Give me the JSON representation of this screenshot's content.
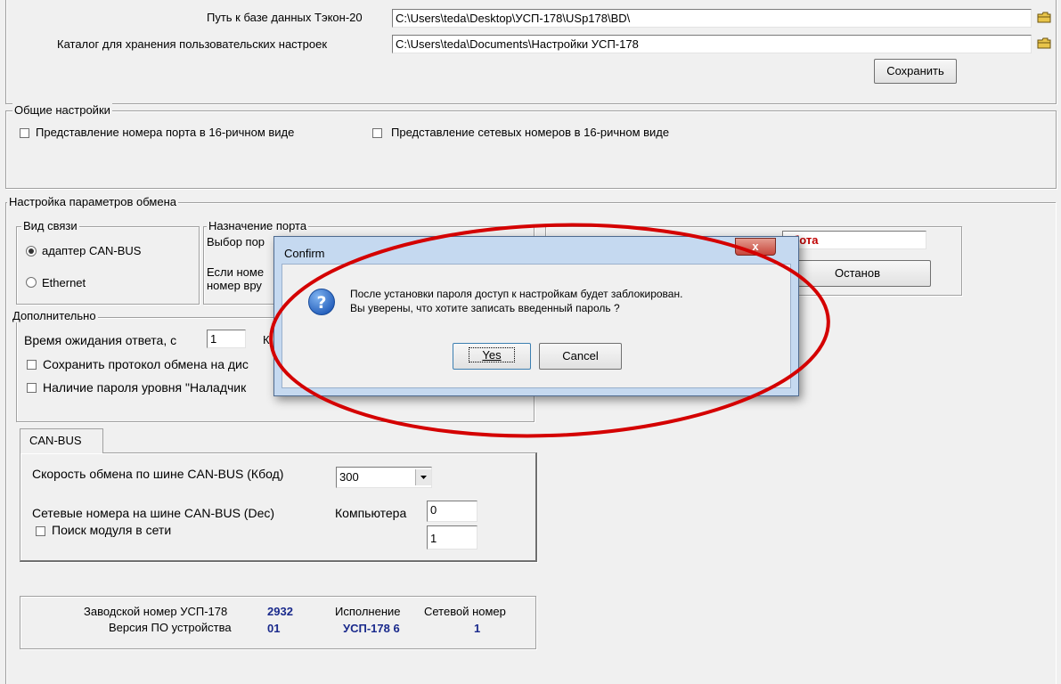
{
  "paths": {
    "db_label": "Путь к базе данных Тэкон-20",
    "db_value": "C:\\Users\\teda\\Desktop\\УСП-178\\USp178\\BD\\",
    "settings_label": "Каталог для хранения пользовательских настроек",
    "settings_value": "C:\\Users\\teda\\Documents\\Настройки УСП-178",
    "save_button": "Сохранить"
  },
  "general": {
    "title": "Общие настройки",
    "port_hex": "Представление номера порта в 16-ричном виде",
    "net_hex": "Представление сетевых номеров в 16-ричном виде"
  },
  "exchange": {
    "title": "Настройка параметров обмена",
    "link": {
      "title": "Вид связи",
      "can_bus": "адаптер CAN-BUS",
      "ethernet": "Ethernet"
    },
    "port": {
      "title": "Назначение порта",
      "select_label": "Выбор пор",
      "manual_line1": "Если номе",
      "manual_line2": "номер вру"
    },
    "status": {
      "value": "абота",
      "stop_button": "Останов"
    },
    "extra": {
      "title": "Дополнительно",
      "timeout_label": "Время ожидания ответа, с",
      "timeout_value": "1",
      "timeout_suffix": "К",
      "save_protocol": "Сохранить протокол обмена на дис",
      "password": "Наличие пароля уровня \"Наладчик"
    }
  },
  "canbus": {
    "tab": "CAN-BUS",
    "speed_label": "Скорость обмена по шине CAN-BUS (Кбод)",
    "speed_value": "300",
    "net_label": "Сетевые номера на шине CAN-BUS (Dec)",
    "computer_label": "Компьютера",
    "computer_value": "0",
    "module_value": "1",
    "search_label": "Поиск модуля в сети"
  },
  "device": {
    "serial_label": "Заводской номер УСП-178",
    "serial_value": "2932",
    "version_label": "Версия ПО устройства",
    "version_value": "01",
    "exec_label": "Исполнение",
    "exec_value": "УСП-178 6",
    "net_label": "Сетевой номер",
    "net_value": "1"
  },
  "dialog": {
    "title": "Confirm",
    "message_line1": "После установки пароля доступ к настройкам будет заблокирован.",
    "message_line2": "Вы уверены, что хотите записать введенный пароль ?",
    "yes": "Yes",
    "cancel": "Cancel",
    "close": "x"
  },
  "colors": {
    "highlight": "#d40000",
    "status_text": "#c00000",
    "value_blue": "#1a2a8c",
    "title_close": "#c7463b"
  }
}
